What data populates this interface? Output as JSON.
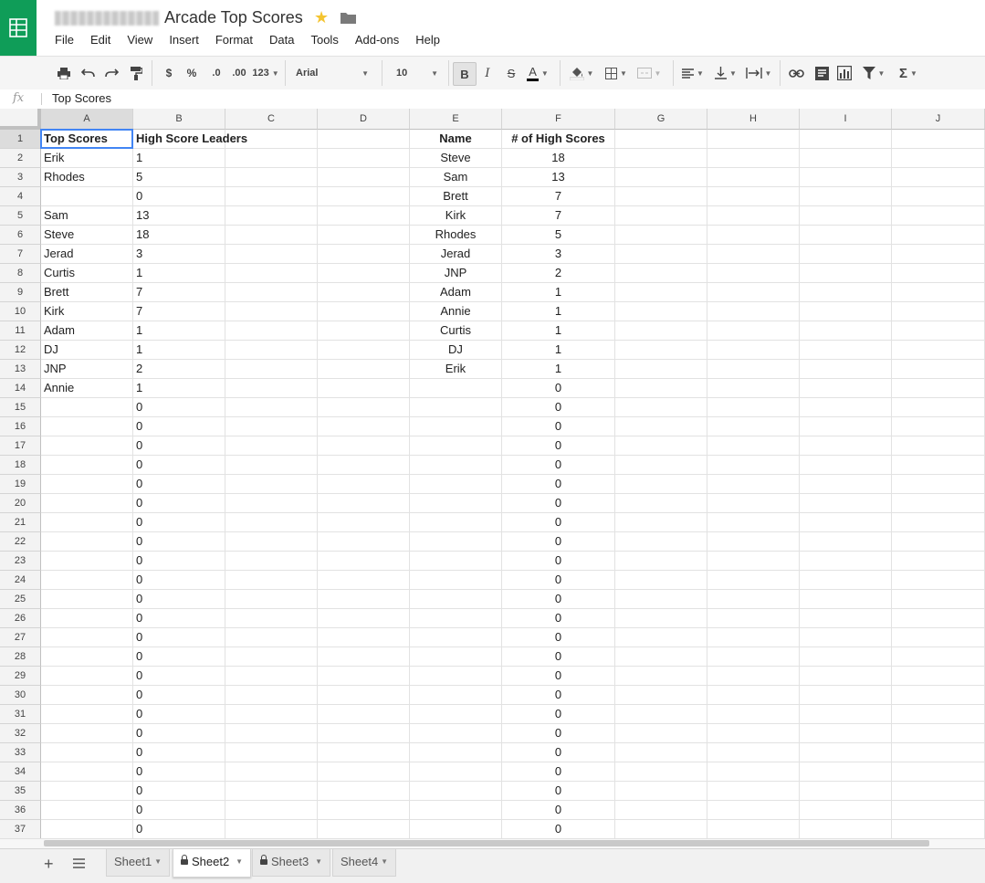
{
  "app": {
    "title": "Arcade Top Scores",
    "menus": [
      "File",
      "Edit",
      "View",
      "Insert",
      "Format",
      "Data",
      "Tools",
      "Add-ons",
      "Help"
    ]
  },
  "toolbar": {
    "currency": "$",
    "percent": "%",
    "dec_decrease": ".0",
    "dec_increase": ".00",
    "format_more": "123",
    "font": "Arial",
    "font_size": "10",
    "bold": "B",
    "italic": "I",
    "strikethrough": "S",
    "text_color": "A",
    "sum": "Σ"
  },
  "formula_bar": {
    "fx": "fx",
    "content": "Top Scores"
  },
  "sheet": {
    "columns": [
      "A",
      "B",
      "C",
      "D",
      "E",
      "F",
      "G",
      "H",
      "I",
      "J"
    ],
    "selected_cell": "A1",
    "rows": [
      [
        "Top Scores",
        "High Score Leaders",
        "",
        "",
        "Name",
        "# of High Scores"
      ],
      [
        "Erik",
        "1",
        "",
        "",
        "Steve",
        "18"
      ],
      [
        "Rhodes",
        "5",
        "",
        "",
        "Sam",
        "13"
      ],
      [
        "",
        "0",
        "",
        "",
        "Brett",
        "7"
      ],
      [
        "Sam",
        "13",
        "",
        "",
        "Kirk",
        "7"
      ],
      [
        "Steve",
        "18",
        "",
        "",
        "Rhodes",
        "5"
      ],
      [
        "Jerad",
        "3",
        "",
        "",
        "Jerad",
        "3"
      ],
      [
        "Curtis",
        "1",
        "",
        "",
        "JNP",
        "2"
      ],
      [
        "Brett",
        "7",
        "",
        "",
        "Adam",
        "1"
      ],
      [
        "Kirk",
        "7",
        "",
        "",
        "Annie",
        "1"
      ],
      [
        "Adam",
        "1",
        "",
        "",
        "Curtis",
        "1"
      ],
      [
        "DJ",
        "1",
        "",
        "",
        "DJ",
        "1"
      ],
      [
        "JNP",
        "2",
        "",
        "",
        "Erik",
        "1"
      ],
      [
        "Annie",
        "1",
        "",
        "",
        "",
        "0"
      ],
      [
        "",
        "0",
        "",
        "",
        "",
        "0"
      ],
      [
        "",
        "0",
        "",
        "",
        "",
        "0"
      ],
      [
        "",
        "0",
        "",
        "",
        "",
        "0"
      ],
      [
        "",
        "0",
        "",
        "",
        "",
        "0"
      ],
      [
        "",
        "0",
        "",
        "",
        "",
        "0"
      ],
      [
        "",
        "0",
        "",
        "",
        "",
        "0"
      ],
      [
        "",
        "0",
        "",
        "",
        "",
        "0"
      ],
      [
        "",
        "0",
        "",
        "",
        "",
        "0"
      ],
      [
        "",
        "0",
        "",
        "",
        "",
        "0"
      ],
      [
        "",
        "0",
        "",
        "",
        "",
        "0"
      ],
      [
        "",
        "0",
        "",
        "",
        "",
        "0"
      ],
      [
        "",
        "0",
        "",
        "",
        "",
        "0"
      ],
      [
        "",
        "0",
        "",
        "",
        "",
        "0"
      ],
      [
        "",
        "0",
        "",
        "",
        "",
        "0"
      ],
      [
        "",
        "0",
        "",
        "",
        "",
        "0"
      ],
      [
        "",
        "0",
        "",
        "",
        "",
        "0"
      ],
      [
        "",
        "0",
        "",
        "",
        "",
        "0"
      ],
      [
        "",
        "0",
        "",
        "",
        "",
        "0"
      ],
      [
        "",
        "0",
        "",
        "",
        "",
        "0"
      ],
      [
        "",
        "0",
        "",
        "",
        "",
        "0"
      ],
      [
        "",
        "0",
        "",
        "",
        "",
        "0"
      ],
      [
        "",
        "0",
        "",
        "",
        "",
        "0"
      ],
      [
        "",
        "0",
        "",
        "",
        "",
        "0"
      ]
    ]
  },
  "tabs": [
    {
      "label": "Sheet1",
      "locked": false,
      "active": false
    },
    {
      "label": "Sheet2",
      "locked": true,
      "active": true
    },
    {
      "label": "Sheet3",
      "locked": true,
      "active": false
    },
    {
      "label": "Sheet4",
      "locked": false,
      "active": false
    }
  ],
  "colors": {
    "brand": "#0f9d58",
    "selection": "#4285f4",
    "star": "#f4c430"
  }
}
